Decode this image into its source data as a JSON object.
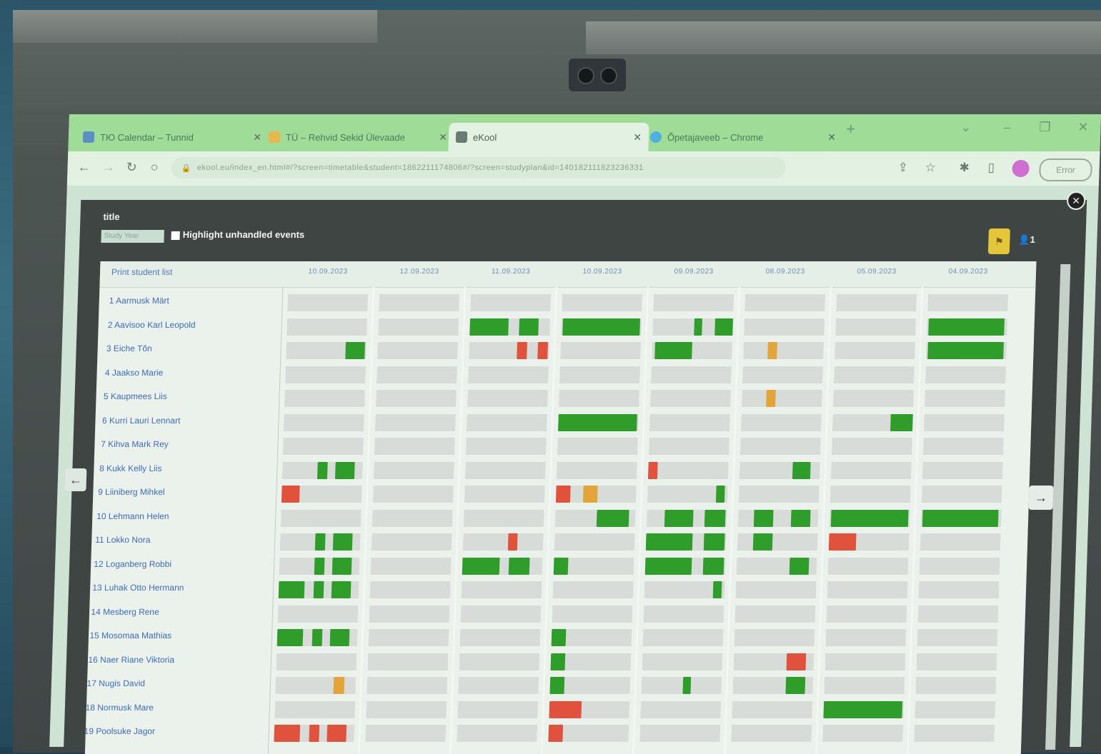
{
  "browser": {
    "tabs": [
      {
        "label": "ТЮ Calendar – Tunnid"
      },
      {
        "label": "TÜ – Rehvid Sekid Ülevaade"
      },
      {
        "label": "eKool"
      },
      {
        "label": "Õpetajaveeb – Chrome"
      }
    ],
    "new_tab": "+",
    "url": "ekool.eu/index_en.html#/?screen=timetable&student=1862211174806#/?screen=studyplan&id=140182111823236331",
    "profile_label": "Error"
  },
  "modal": {
    "title": "title",
    "view_select": "Study Year",
    "highlight_label": "Highlight unhandled events",
    "user_count": "1",
    "timeline": {
      "student_header": "Print student list",
      "dates": [
        "10.09.2023",
        "12.09.2023",
        "11.09.2023",
        "10.09.2023",
        "09.09.2023",
        "08.09.2023",
        "05.09.2023",
        "04.09.2023"
      ],
      "students": [
        "1 Aarmusk Märt",
        "2 Aavisoo Karl Leopold",
        "3 Eiche Tõn",
        "4 Jaakso Marie",
        "5 Kaupmees Liis",
        "6 Kurri Lauri Lennart",
        "7 Kihva Mark Rey",
        "8 Kukk Kelly Liis",
        "9 Liiniberg Mihkel",
        "10 Lehmann Helen",
        "11 Lokko Nora",
        "12 Loganberg Robbi",
        "13 Luhak Otto Hermann",
        "14 Mesberg Rene",
        "15 Mosomaa Mathias",
        "16 Naer Riane Viktoria",
        "17 Nugis David",
        "18 Normusk Mare",
        "19 Poolsuke Jagor"
      ],
      "events": [
        {
          "row": 1,
          "day": 2,
          "start": 0.0,
          "end": 0.48,
          "color": "green"
        },
        {
          "row": 1,
          "day": 2,
          "start": 0.62,
          "end": 0.86,
          "color": "green"
        },
        {
          "row": 1,
          "day": 3,
          "start": 0.02,
          "end": 0.98,
          "color": "green"
        },
        {
          "row": 1,
          "day": 4,
          "start": 0.52,
          "end": 0.62,
          "color": "green"
        },
        {
          "row": 1,
          "day": 4,
          "start": 0.78,
          "end": 1.0,
          "color": "green"
        },
        {
          "row": 1,
          "day": 7,
          "start": 0.02,
          "end": 0.96,
          "color": "green"
        },
        {
          "row": 2,
          "day": 0,
          "start": 0.74,
          "end": 0.98,
          "color": "green"
        },
        {
          "row": 2,
          "day": 2,
          "start": 0.6,
          "end": 0.72,
          "color": "red"
        },
        {
          "row": 2,
          "day": 2,
          "start": 0.86,
          "end": 0.98,
          "color": "red"
        },
        {
          "row": 2,
          "day": 4,
          "start": 0.04,
          "end": 0.5,
          "color": "green"
        },
        {
          "row": 2,
          "day": 5,
          "start": 0.3,
          "end": 0.42,
          "color": "orange"
        },
        {
          "row": 2,
          "day": 7,
          "start": 0.02,
          "end": 0.96,
          "color": "green"
        },
        {
          "row": 4,
          "day": 5,
          "start": 0.3,
          "end": 0.42,
          "color": "orange"
        },
        {
          "row": 5,
          "day": 3,
          "start": 0.0,
          "end": 0.98,
          "color": "green"
        },
        {
          "row": 5,
          "day": 6,
          "start": 0.72,
          "end": 1.0,
          "color": "green"
        },
        {
          "row": 7,
          "day": 0,
          "start": 0.44,
          "end": 0.56,
          "color": "green"
        },
        {
          "row": 7,
          "day": 0,
          "start": 0.66,
          "end": 0.9,
          "color": "green"
        },
        {
          "row": 7,
          "day": 4,
          "start": 0.0,
          "end": 0.12,
          "color": "red"
        },
        {
          "row": 7,
          "day": 5,
          "start": 0.66,
          "end": 0.88,
          "color": "green"
        },
        {
          "row": 8,
          "day": 0,
          "start": 0.0,
          "end": 0.22,
          "color": "red"
        },
        {
          "row": 8,
          "day": 3,
          "start": 0.0,
          "end": 0.18,
          "color": "red"
        },
        {
          "row": 8,
          "day": 3,
          "start": 0.34,
          "end": 0.52,
          "color": "orange"
        },
        {
          "row": 8,
          "day": 4,
          "start": 0.86,
          "end": 0.96,
          "color": "green"
        },
        {
          "row": 9,
          "day": 3,
          "start": 0.52,
          "end": 0.92,
          "color": "green"
        },
        {
          "row": 9,
          "day": 4,
          "start": 0.22,
          "end": 0.58,
          "color": "green"
        },
        {
          "row": 9,
          "day": 4,
          "start": 0.72,
          "end": 0.98,
          "color": "green"
        },
        {
          "row": 9,
          "day": 5,
          "start": 0.2,
          "end": 0.44,
          "color": "green"
        },
        {
          "row": 9,
          "day": 5,
          "start": 0.66,
          "end": 0.9,
          "color": "green"
        },
        {
          "row": 9,
          "day": 6,
          "start": 0.02,
          "end": 0.98,
          "color": "green"
        },
        {
          "row": 9,
          "day": 7,
          "start": 0.02,
          "end": 0.96,
          "color": "green"
        },
        {
          "row": 10,
          "day": 0,
          "start": 0.44,
          "end": 0.56,
          "color": "green"
        },
        {
          "row": 10,
          "day": 0,
          "start": 0.66,
          "end": 0.9,
          "color": "green"
        },
        {
          "row": 10,
          "day": 2,
          "start": 0.56,
          "end": 0.68,
          "color": "red"
        },
        {
          "row": 10,
          "day": 4,
          "start": 0.0,
          "end": 0.58,
          "color": "green"
        },
        {
          "row": 10,
          "day": 4,
          "start": 0.72,
          "end": 0.98,
          "color": "green"
        },
        {
          "row": 10,
          "day": 5,
          "start": 0.2,
          "end": 0.44,
          "color": "green"
        },
        {
          "row": 10,
          "day": 6,
          "start": 0.0,
          "end": 0.34,
          "color": "red"
        },
        {
          "row": 11,
          "day": 0,
          "start": 0.44,
          "end": 0.56,
          "color": "green"
        },
        {
          "row": 11,
          "day": 0,
          "start": 0.66,
          "end": 0.9,
          "color": "green"
        },
        {
          "row": 11,
          "day": 2,
          "start": 0.0,
          "end": 0.46,
          "color": "green"
        },
        {
          "row": 11,
          "day": 2,
          "start": 0.58,
          "end": 0.84,
          "color": "green"
        },
        {
          "row": 11,
          "day": 3,
          "start": 0.0,
          "end": 0.18,
          "color": "green"
        },
        {
          "row": 11,
          "day": 4,
          "start": 0.0,
          "end": 0.58,
          "color": "green"
        },
        {
          "row": 11,
          "day": 4,
          "start": 0.72,
          "end": 0.98,
          "color": "green"
        },
        {
          "row": 11,
          "day": 5,
          "start": 0.66,
          "end": 0.9,
          "color": "green"
        },
        {
          "row": 12,
          "day": 0,
          "start": 0.0,
          "end": 0.32,
          "color": "green"
        },
        {
          "row": 12,
          "day": 0,
          "start": 0.44,
          "end": 0.56,
          "color": "green"
        },
        {
          "row": 12,
          "day": 0,
          "start": 0.66,
          "end": 0.9,
          "color": "green"
        },
        {
          "row": 12,
          "day": 4,
          "start": 0.86,
          "end": 0.96,
          "color": "green"
        },
        {
          "row": 14,
          "day": 0,
          "start": 0.0,
          "end": 0.32,
          "color": "green"
        },
        {
          "row": 14,
          "day": 0,
          "start": 0.44,
          "end": 0.56,
          "color": "green"
        },
        {
          "row": 14,
          "day": 0,
          "start": 0.66,
          "end": 0.9,
          "color": "green"
        },
        {
          "row": 14,
          "day": 3,
          "start": 0.0,
          "end": 0.18,
          "color": "green"
        },
        {
          "row": 15,
          "day": 3,
          "start": 0.0,
          "end": 0.18,
          "color": "green"
        },
        {
          "row": 15,
          "day": 5,
          "start": 0.66,
          "end": 0.9,
          "color": "red"
        },
        {
          "row": 16,
          "day": 0,
          "start": 0.72,
          "end": 0.86,
          "color": "orange"
        },
        {
          "row": 16,
          "day": 3,
          "start": 0.0,
          "end": 0.18,
          "color": "green"
        },
        {
          "row": 16,
          "day": 4,
          "start": 0.52,
          "end": 0.62,
          "color": "green"
        },
        {
          "row": 16,
          "day": 5,
          "start": 0.66,
          "end": 0.9,
          "color": "green"
        },
        {
          "row": 17,
          "day": 3,
          "start": 0.0,
          "end": 0.4,
          "color": "red"
        },
        {
          "row": 17,
          "day": 6,
          "start": 0.0,
          "end": 0.98,
          "color": "green"
        },
        {
          "row": 18,
          "day": 0,
          "start": 0.0,
          "end": 0.32,
          "color": "red"
        },
        {
          "row": 18,
          "day": 0,
          "start": 0.44,
          "end": 0.56,
          "color": "red"
        },
        {
          "row": 18,
          "day": 0,
          "start": 0.66,
          "end": 0.9,
          "color": "red"
        },
        {
          "row": 18,
          "day": 3,
          "start": 0.0,
          "end": 0.18,
          "color": "red"
        }
      ]
    }
  }
}
